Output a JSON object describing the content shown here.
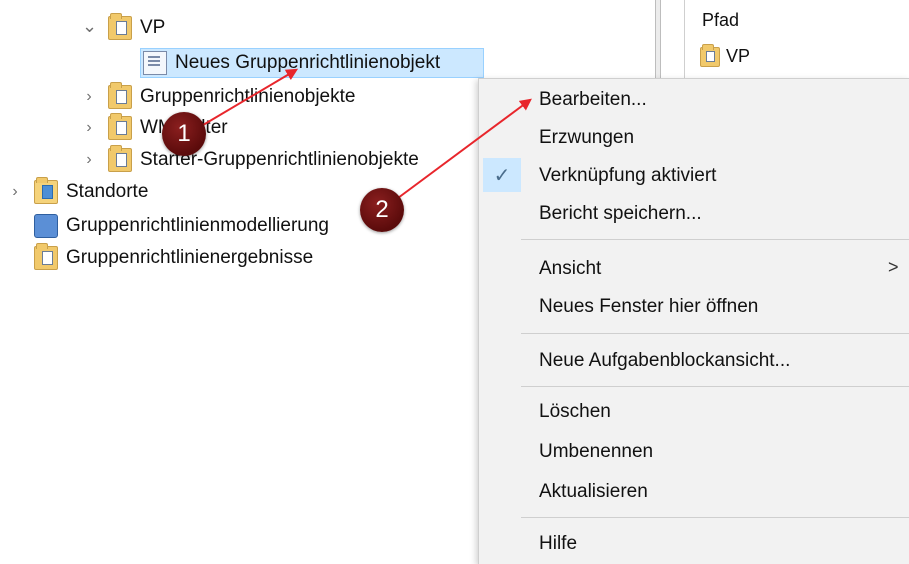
{
  "tree": {
    "items": [
      {
        "label": "VP",
        "expanded": true
      },
      {
        "label": "Neues Gruppenrichtlinienobjekt"
      },
      {
        "label": "Gruppenrichtlinienobjekte"
      },
      {
        "label": "WMI-Filter"
      },
      {
        "label": "Starter-Gruppenrichtlinienobjekte"
      },
      {
        "label": "Standorte"
      },
      {
        "label": "Gruppenrichtlinienmodellierung"
      },
      {
        "label": "Gruppenrichtlinienergebnisse"
      }
    ]
  },
  "right_pane": {
    "header": "Pfad",
    "rows": [
      {
        "label": "VP"
      }
    ]
  },
  "context_menu": {
    "items": [
      {
        "label": "Bearbeiten..."
      },
      {
        "label": "Erzwungen"
      },
      {
        "label": "Verknüpfung aktiviert",
        "checked": true
      },
      {
        "label": "Bericht speichern..."
      },
      {
        "label": "Ansicht",
        "submenu_arrow": ">"
      },
      {
        "label": "Neues Fenster hier öffnen"
      },
      {
        "label": "Neue Aufgabenblockansicht..."
      },
      {
        "label": "Löschen"
      },
      {
        "label": "Umbenennen"
      },
      {
        "label": "Aktualisieren"
      },
      {
        "label": "Hilfe"
      }
    ],
    "check_glyph": "✓"
  },
  "annotations": {
    "badge_1": "1",
    "badge_2": "2",
    "arrow_color": "#e8262c",
    "badge_color": "#6e1212"
  },
  "glyphs": {
    "chevron_down": "⌄",
    "chevron_right": "›"
  }
}
